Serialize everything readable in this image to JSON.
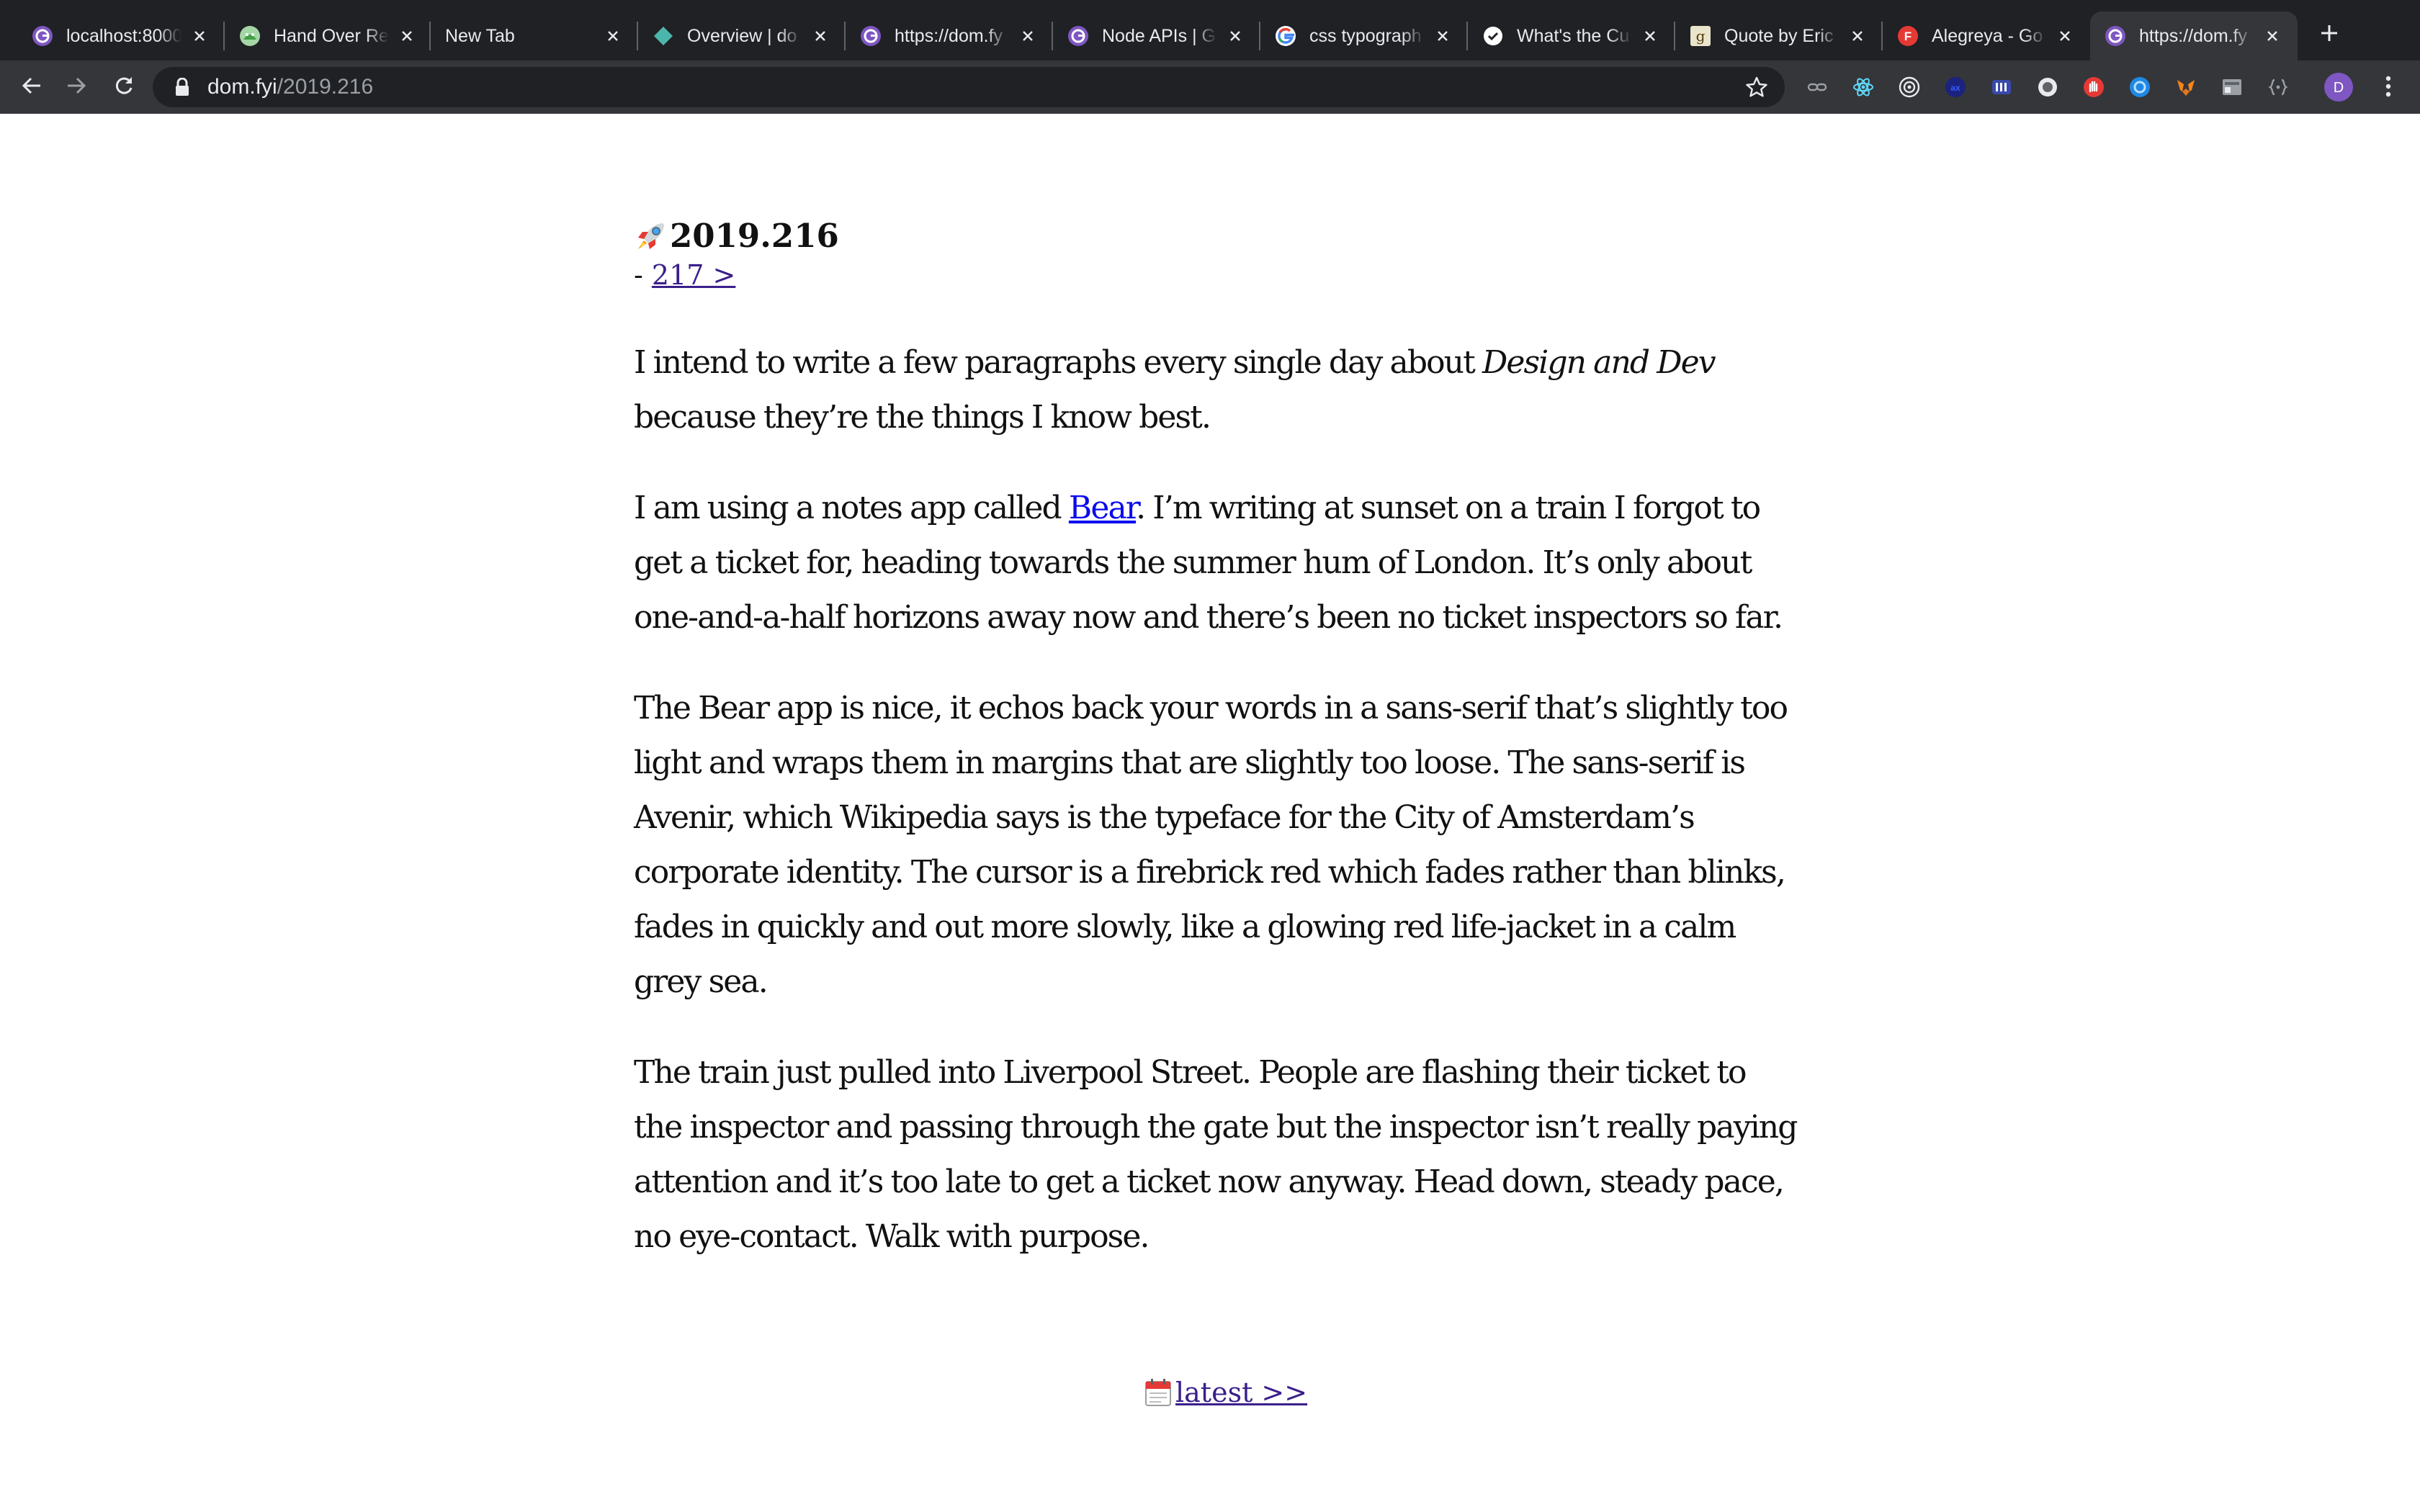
{
  "browser": {
    "tabs": [
      {
        "title": "localhost:8000",
        "favicon": "dom-fyi-icon",
        "active": false
      },
      {
        "title": "Hand Over Re",
        "favicon": "hand-over-icon",
        "active": false
      },
      {
        "title": "New Tab",
        "favicon": "",
        "active": false
      },
      {
        "title": "Overview | do",
        "favicon": "diamond-icon",
        "active": false
      },
      {
        "title": "https://dom.fy",
        "favicon": "dom-fyi-icon",
        "active": false
      },
      {
        "title": "Node APIs | G",
        "favicon": "dom-fyi-icon",
        "active": false
      },
      {
        "title": "css typograph",
        "favicon": "google-icon",
        "active": false
      },
      {
        "title": "What's the Cu",
        "favicon": "check-circle-icon",
        "active": false
      },
      {
        "title": "Quote by Eric",
        "favicon": "goodreads-icon",
        "active": false
      },
      {
        "title": "Alegreya - Go",
        "favicon": "fonts-icon",
        "active": false
      },
      {
        "title": "https://dom.fy",
        "favicon": "dom-fyi-icon",
        "active": true
      }
    ],
    "url": {
      "host": "dom.fyi",
      "path": "/2019.216"
    },
    "profile_initial": "D",
    "colors": {
      "tabstrip": "#202124",
      "toolbar": "#35363a",
      "omnibox": "#202124",
      "profile": "#7e57c2"
    }
  },
  "post": {
    "title": "2019.216",
    "nav": {
      "prefix": "- ",
      "next_label": "217 >"
    },
    "paragraphs": {
      "p1": {
        "before": "I intend to write a few paragraphs every single day about ",
        "em": "Design and Dev",
        "after": " because they’re the things I know best."
      },
      "p2": {
        "before": "I am using a notes app called ",
        "link": "Bear",
        "after": ". I’m writing at sunset on a train I forgot to get a ticket for, heading towards the summer hum of London. It’s only about one-and-a-half horizons away now and there’s been no ticket inspectors so far."
      },
      "p3": "The Bear app is nice, it echos back your words in a sans-serif that’s slightly too light and wraps them in margins that are slightly too loose. The sans-serif is Avenir, which Wikipedia says is the typeface for the City of Amsterdam’s corporate identity. The cursor is a firebrick red which fades rather than blinks, fades in quickly and out more slowly, like a glowing red life-jacket in a calm grey sea.",
      "p4": "The train just pulled into Liverpool Street. People are flashing their ticket to the inspector and passing through the gate but the inspector isn’t really paying attention and it’s too late to get a ticket now anyway. Head down, steady pace, no eye-contact. Walk with purpose."
    },
    "footer_link": "latest >>",
    "link_color": "#0a0aee",
    "visited_color": "#3b1f8c"
  }
}
